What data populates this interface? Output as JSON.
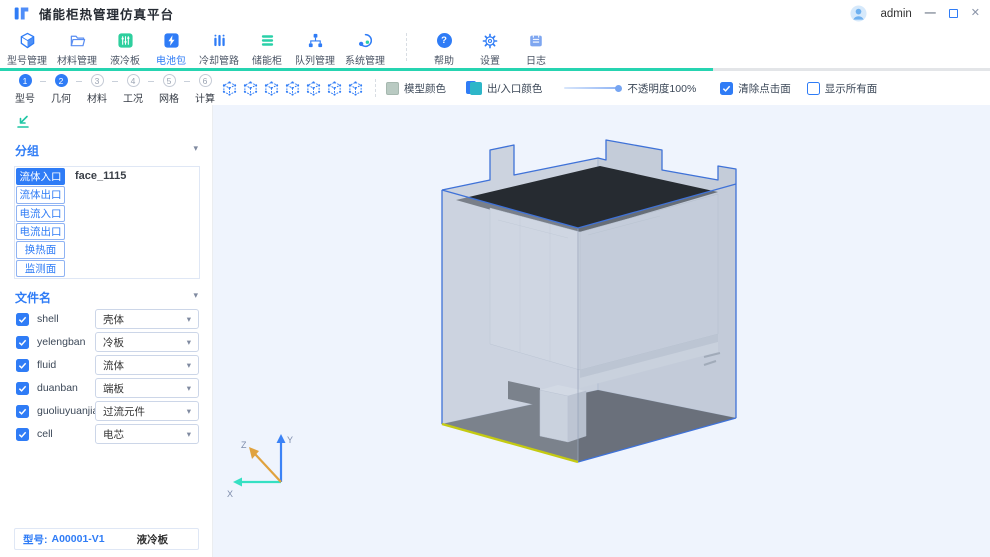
{
  "window": {
    "title": "储能柜热管理仿真平台",
    "user": "admin"
  },
  "icons": {
    "caret_down": "▾",
    "minimize": "—",
    "close": "✕",
    "help_glyph": "?"
  },
  "nav": {
    "items": [
      {
        "label": "型号管理",
        "icon": "model-cube-icon",
        "active": false
      },
      {
        "label": "材料管理",
        "icon": "material-folder-icon",
        "active": false
      },
      {
        "label": "液冷板",
        "icon": "liquid-cold-plate-icon",
        "active": false
      },
      {
        "label": "电池包",
        "icon": "battery-pack-icon",
        "active": true
      },
      {
        "label": "冷却管路",
        "icon": "cooling-pipes-icon",
        "active": false
      },
      {
        "label": "储能柜",
        "icon": "storage-cabinet-icon",
        "active": false
      },
      {
        "label": "队列管理",
        "icon": "queue-tree-icon",
        "active": false
      },
      {
        "label": "系统管理",
        "icon": "system-management-icon",
        "active": false
      }
    ],
    "utility": [
      {
        "label": "帮助",
        "icon": "help-icon"
      },
      {
        "label": "设置",
        "icon": "settings-gear-icon"
      },
      {
        "label": "日志",
        "icon": "log-icon"
      }
    ]
  },
  "progress": {
    "percent": 72,
    "color": "#26d4b1"
  },
  "steps": [
    {
      "number": "1",
      "label": "型号",
      "active": true
    },
    {
      "number": "2",
      "label": "几何",
      "active": true
    },
    {
      "number": "3",
      "label": "材料",
      "active": false
    },
    {
      "number": "4",
      "label": "工况",
      "active": false
    },
    {
      "number": "5",
      "label": "网格",
      "active": false
    },
    {
      "number": "6",
      "label": "计算",
      "active": false
    }
  ],
  "viewer_toolbar": {
    "view_cube_count": 7,
    "model_color_label": "模型颜色",
    "model_color": "#b9cac2",
    "inlet_outlet_label": "出/入口颜色",
    "inlet_outlet_color": "#2db6c8",
    "opacity_label": "不透明度100%",
    "opacity_percent": 100,
    "clear_click_label": "清除点击面",
    "clear_click_checked": true,
    "show_all_label": "显示所有面",
    "show_all_checked": false
  },
  "sidebar": {
    "groups_title": "分组",
    "groups": [
      {
        "label": "流体入口",
        "selected": true
      },
      {
        "label": "流体出口",
        "selected": false
      },
      {
        "label": "电流入口",
        "selected": false
      },
      {
        "label": "电流出口",
        "selected": false
      },
      {
        "label": "换热面",
        "selected": false
      },
      {
        "label": "监测面",
        "selected": false
      }
    ],
    "selected_face": "face_1115",
    "files_title": "文件名",
    "files": [
      {
        "name": "shell",
        "type": "壳体",
        "checked": true
      },
      {
        "name": "yelengban",
        "type": "冷板",
        "checked": true
      },
      {
        "name": "fluid",
        "type": "流体",
        "checked": true
      },
      {
        "name": "duanban",
        "type": "端板",
        "checked": true
      },
      {
        "name": "guoliuyuanjian",
        "type": "过流元件",
        "checked": true
      },
      {
        "name": "cell",
        "type": "电芯",
        "checked": true
      }
    ],
    "status": {
      "label": "型号:",
      "value": "A00001-V1",
      "component": "液冷板"
    }
  },
  "viewport": {
    "axes": {
      "x": "X",
      "y": "Y",
      "z": "Z"
    }
  },
  "colors": {
    "primary": "#2f7cf6",
    "teal": "#26d4b1",
    "edge_blue": "#3f72d8",
    "selected_edge_yellow": "#c4ca12",
    "viewport_bg": "#eff4fd",
    "interior_dark": "#2b3037"
  }
}
